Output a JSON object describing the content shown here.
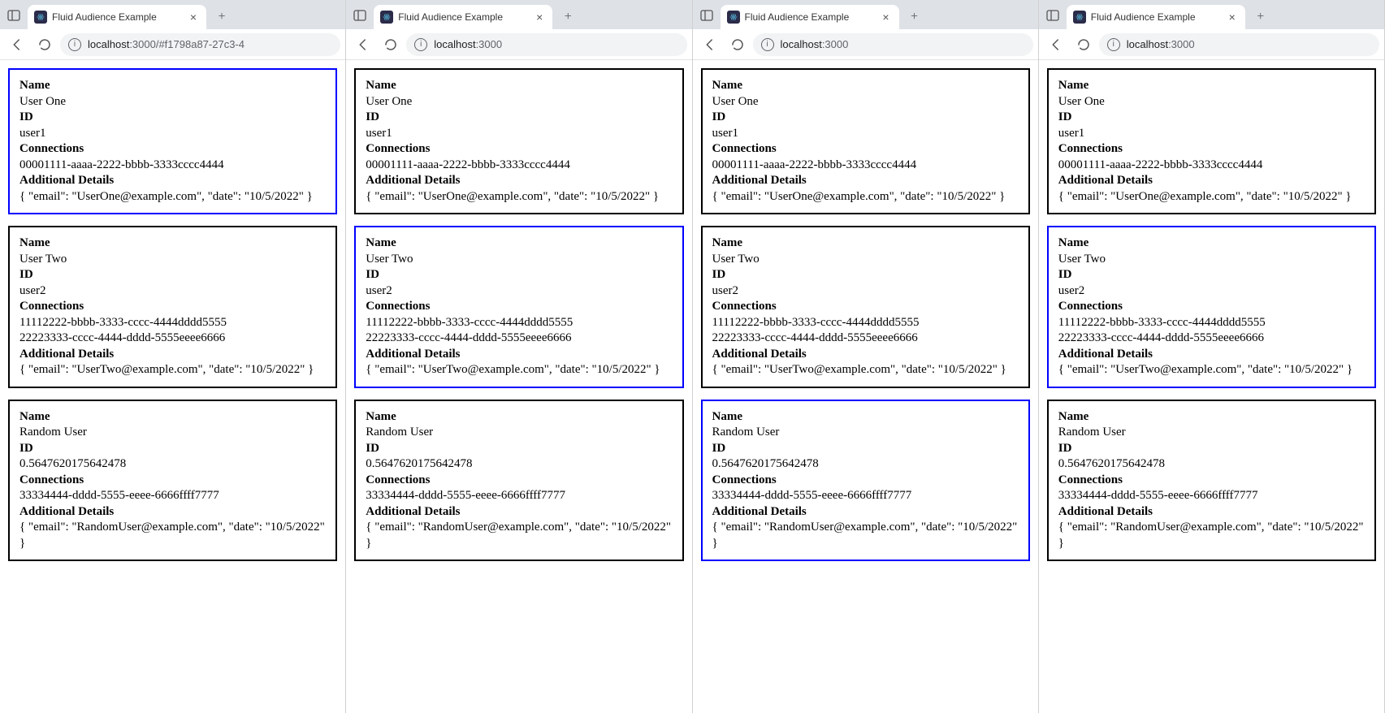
{
  "tab_title": "Fluid Audience Example",
  "labels": {
    "name": "Name",
    "id": "ID",
    "connections": "Connections",
    "details": "Additional Details"
  },
  "users": [
    {
      "name": "User One",
      "id": "user1",
      "connections": [
        "00001111-aaaa-2222-bbbb-3333cccc4444"
      ],
      "details": "{ \"email\": \"UserOne@example.com\", \"date\": \"10/5/2022\" }"
    },
    {
      "name": "User Two",
      "id": "user2",
      "connections": [
        "11112222-bbbb-3333-cccc-4444dddd5555",
        "22223333-cccc-4444-dddd-5555eeee6666"
      ],
      "details": "{ \"email\": \"UserTwo@example.com\", \"date\": \"10/5/2022\" }"
    },
    {
      "name": "Random User",
      "id": "0.5647620175642478",
      "connections": [
        "33334444-dddd-5555-eeee-6666ffff7777"
      ],
      "details": "{ \"email\": \"RandomUser@example.com\", \"date\": \"10/5/2022\" }"
    }
  ],
  "windows": [
    {
      "url_host": "localhost",
      "url_path": ":3000/#f1798a87-27c3-4",
      "selected_index": 0
    },
    {
      "url_host": "localhost",
      "url_path": ":3000",
      "selected_index": 1
    },
    {
      "url_host": "localhost",
      "url_path": ":3000",
      "selected_index": 2
    },
    {
      "url_host": "localhost",
      "url_path": ":3000",
      "selected_index": 1
    }
  ]
}
